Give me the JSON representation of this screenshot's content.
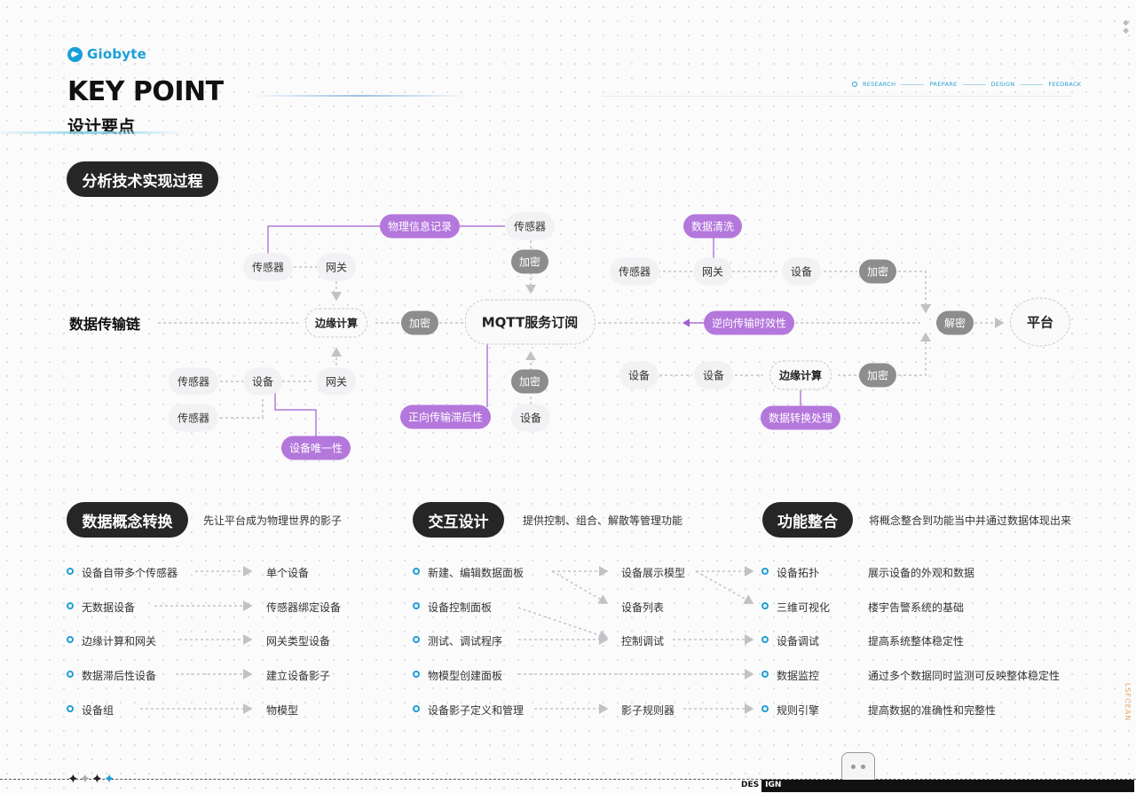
{
  "header": {
    "logo": "Giobyte",
    "title_en": "KEY POINT",
    "title_cn": "设计要点",
    "nav": [
      "RESEARCH",
      "PREPARE",
      "DESIGN",
      "FEEDBACK"
    ]
  },
  "section_title": "分析技术实现过程",
  "chain_label": "数据传输链",
  "nodes": {
    "sensor": "传感器",
    "gateway": "网关",
    "device": "设备",
    "edge": "边缘计算",
    "encrypt": "加密",
    "decrypt": "解密",
    "mqtt": "MQTT服务订阅",
    "platform": "平台"
  },
  "annotations": {
    "physical_info": "物理信息记录",
    "data_clean": "数据清洗",
    "reverse_timeliness": "逆向传输时效性",
    "forward_lag": "正向传输滞后性",
    "device_unique": "设备唯一性",
    "data_convert": "数据转换处理"
  },
  "columns": [
    {
      "title": "数据概念转换",
      "desc": "先让平台成为物理世界的影子",
      "left": [
        "设备自带多个传感器",
        "无数据设备",
        "边缘计算和网关",
        "数据滞后性设备",
        "设备组"
      ],
      "right": [
        "单个设备",
        "传感器绑定设备",
        "网关类型设备",
        "建立设备影子",
        "物模型"
      ]
    },
    {
      "title": "交互设计",
      "desc": "提供控制、组合、解散等管理功能",
      "left": [
        "新建、编辑数据面板",
        "设备控制面板",
        "测试、调试程序",
        "物模型创建面板",
        "设备影子定义和管理"
      ],
      "right": [
        "设备展示模型",
        "设备列表",
        "控制调试",
        "影子规则器"
      ]
    },
    {
      "title": "功能整合",
      "desc": "将概念整合到功能当中并通过数据体现出来",
      "left": [
        "设备拓扑",
        "三维可视化",
        "设备调试",
        "数据监控",
        "规则引擎"
      ],
      "right": [
        "展示设备的外观和数据",
        "楼宇告警系统的基础",
        "提高系统整体稳定性",
        "通过多个数据同时监测可反映整体稳定性",
        "提高数据的准确性和完整性"
      ]
    }
  ],
  "footer": {
    "design_a": "DES",
    "design_b": "IGN",
    "side": "LSFCEAN"
  },
  "colors": {
    "accent_blue": "#1f9fd4",
    "purple": "#b477dc",
    "gray_pill": "#8d8d8d",
    "dark_pill": "#262626"
  }
}
